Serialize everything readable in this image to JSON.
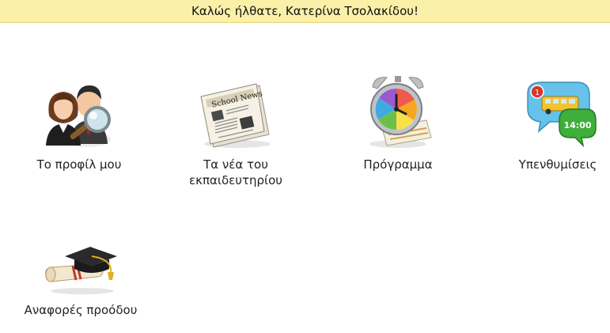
{
  "header": {
    "welcome_text": "Καλώς ήλθατε, Κατερίνα Τσολακίδου!"
  },
  "menu": [
    {
      "id": "profile",
      "label": "Το προφίλ μου",
      "icon": "profile-search-icon"
    },
    {
      "id": "news",
      "label": "Τα νέα του εκπαιδευτηρίου",
      "icon": "newspaper-icon",
      "icon_text": "School News"
    },
    {
      "id": "schedule",
      "label": "Πρόγραμμα",
      "icon": "alarm-clock-icon"
    },
    {
      "id": "reminders",
      "label": "Υπενθυμίσεις",
      "icon": "reminder-bubbles-icon",
      "icon_text": "14:00",
      "badge": "1"
    },
    {
      "id": "reports",
      "label": "Αναφορές προόδου",
      "icon": "graduation-cap-diploma-icon"
    }
  ],
  "colors": {
    "header_bg": "#fbf0a8",
    "label_text": "#222222"
  }
}
